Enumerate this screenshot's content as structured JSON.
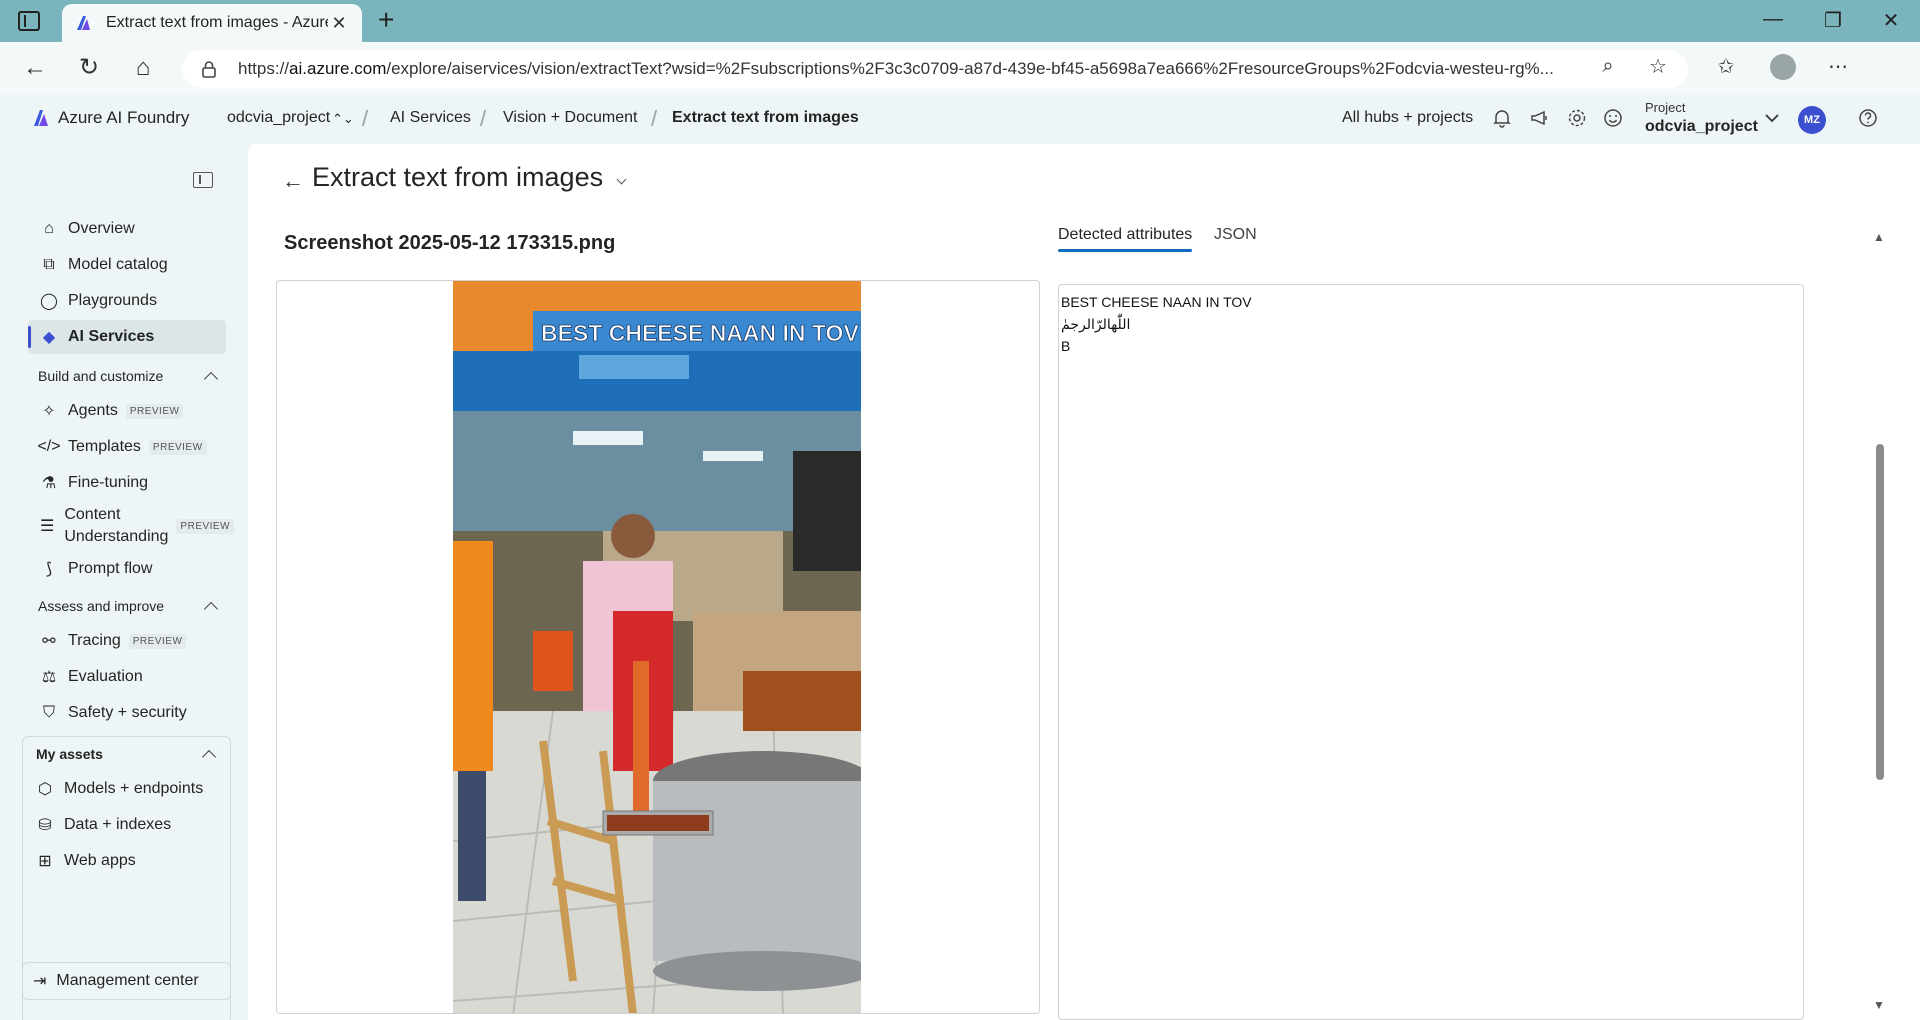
{
  "browser": {
    "tab_title": "Extract text from images - Azure AI Foundry",
    "tab_close": "✕",
    "new_tab": "+",
    "url_host": "ai.azure.com",
    "url_prefix": "https://",
    "url_rest": "/explore/aiservices/vision/extractText?wsid=%2Fsubscriptions%2F3c3c0709-a87d-439e-bf45-a5698a7ea666%2FresourceGroups%2Fodcvia-westeu-rg%..."
  },
  "header": {
    "brand": "Azure AI Foundry",
    "breadcrumb": [
      "odcvia_project",
      "AI Services",
      "Vision + Document",
      "Extract text from images"
    ],
    "all_hubs": "All hubs + projects",
    "project_label": "Project",
    "project_name": "odcvia_project",
    "user_initials": "MZ"
  },
  "sidebar": {
    "top_items": [
      {
        "label": "Overview",
        "icon": "home-icon"
      },
      {
        "label": "Model catalog",
        "icon": "cube-icon"
      },
      {
        "label": "Playgrounds",
        "icon": "chat-icon"
      },
      {
        "label": "AI Services",
        "icon": "ai-services-icon"
      }
    ],
    "build_section": "Build and customize",
    "build_items": [
      {
        "label": "Agents",
        "badge": "PREVIEW"
      },
      {
        "label": "Templates",
        "badge": "PREVIEW"
      },
      {
        "label": "Fine-tuning",
        "badge": ""
      },
      {
        "label": "Content Understanding",
        "badge": "PREVIEW"
      },
      {
        "label": "Prompt flow",
        "badge": ""
      }
    ],
    "assess_section": "Assess and improve",
    "assess_items": [
      {
        "label": "Tracing",
        "badge": "PREVIEW"
      },
      {
        "label": "Evaluation",
        "badge": ""
      },
      {
        "label": "Safety + security",
        "badge": ""
      }
    ],
    "assets_section": "My assets",
    "assets_items": [
      {
        "label": "Models + endpoints"
      },
      {
        "label": "Data + indexes"
      },
      {
        "label": "Web apps"
      }
    ],
    "management": "Management center"
  },
  "main": {
    "title": "Extract text from images",
    "filename": "Screenshot 2025-05-12 173315.png",
    "tabs": [
      "Detected attributes",
      "JSON"
    ],
    "result_lines": [
      "BEST CHEESE NAAN IN TOV",
      "اللّٰهالرّالرجمٰ",
      "B"
    ],
    "photo_sign": "BEST CHEESE NAAN IN TOV"
  },
  "colors": {
    "accent": "#0f6cbd",
    "tabbar": "#7ab4bd",
    "avatar": "#3b4fd1"
  }
}
